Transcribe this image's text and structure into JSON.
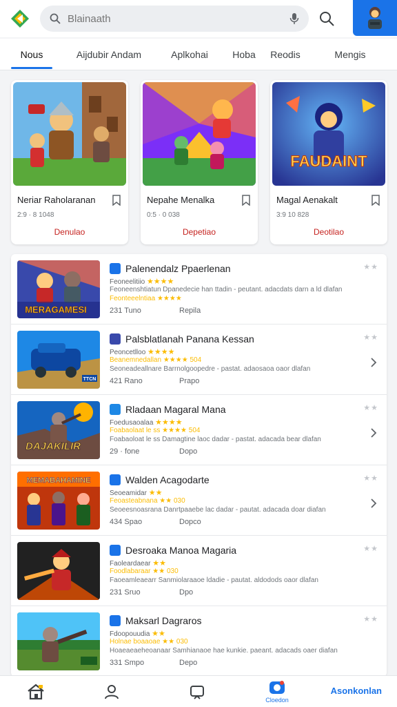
{
  "search": {
    "placeholder": "Blainaath"
  },
  "tabs": [
    {
      "label": "Nous",
      "active": true
    },
    {
      "label": "Aijdubir Andam",
      "active": false
    },
    {
      "label": "Aplkohai",
      "active": false
    },
    {
      "label": "Hoba",
      "active": false
    },
    {
      "label": "Reodis",
      "active": false
    },
    {
      "label": "Mengis",
      "active": false
    }
  ],
  "featured": [
    {
      "title": "Neriar Raholaranan",
      "meta": "2:9 · 8 1048",
      "action": "Denulao"
    },
    {
      "title": "Nepahe Menalka",
      "meta": "0:5 · 0 038",
      "action": "Depetiao"
    },
    {
      "title": "Magal Aenakalt",
      "meta": "3:9 10 828",
      "action": "Deotilao"
    }
  ],
  "featured_art": [
    "FAUDAINT"
  ],
  "list": [
    {
      "name": "Palenendalz Ppaerlenan",
      "sub": "Feoneelitiio",
      "stars": "★★★★",
      "desc": "Feoneenshtiatun  Dpanedecie han ttadin - peutant. adacdats darn a ld dlafan",
      "desc2": "Feonteeelntiaa ★★★★",
      "size": "231 Tuno",
      "price": "Repila",
      "art": "MERAGAMESI",
      "icon_color": "#1a73e8",
      "chevron": false
    },
    {
      "name": "Palsblatlanah Panana Kessan",
      "sub": "Peoncetlloo",
      "stars": "★★★★",
      "desc": "Seoneadeallnare  Barrnolgoopedre - pastat. adaosaoa oaor dlafan",
      "desc2": "Beanemnedallan ★★★★ 504",
      "size": "421 Rano",
      "price": "Prapo",
      "art": "TTCN",
      "icon_color": "#3949ab",
      "chevron": true
    },
    {
      "name": "Rladaan Magaral Mana",
      "sub": "Foedusaoalaa",
      "stars": "★★★★",
      "desc": "Foabaoloat le ss  Damagtine laoc dadar - pastat. adacada bear dlafan",
      "desc2": "Foabaolaat le ss ★★★★ 504",
      "size": "29 · fone",
      "price": "Dopo",
      "art": "DAJAKILIR",
      "icon_color": "#1e88e5",
      "chevron": true
    },
    {
      "name": "Walden Acagodarte",
      "sub": "Seoeamidar",
      "stars": "★★",
      "desc": "Seoeesnoasrana  Danrtpaaebe lac dadar - pautat. adacada doar diafan",
      "desc2": "Feoasteabnana ★★ 030",
      "size": "434 Spao",
      "price": "Dopco",
      "art": "MEMABAHAMINE",
      "icon_color": "#1a73e8",
      "chevron": true
    },
    {
      "name": "Desroaka Manoa Magaria",
      "sub": "Faoleardaear",
      "stars": "★★",
      "desc": "Faoeamleaearr  Sanmiolaraaoe ldadie - pautat. aldodods oaor dlafan",
      "desc2": "Foodlabaraar ★★ 030",
      "size": "231 Sruo",
      "price": "Dpo",
      "art": "",
      "icon_color": "#1a73e8",
      "chevron": false
    },
    {
      "name": "Maksarl Dagraros",
      "sub": "Fdoopouudia",
      "stars": "★★",
      "desc": "Hoaeaeaeheoanaar  Samhianaoe hae kunkie. paeant. adacads oaer diafan",
      "desc2": "Holnae boaaoae ★★ 030",
      "size": "331 Smpo",
      "price": "Depo",
      "art": "",
      "icon_color": "#1a73e8",
      "chevron": false
    }
  ],
  "bottom_nav": {
    "tab_label": "Cloedon",
    "account_label": "Asonkonlan"
  },
  "colors": {
    "accent": "#1a73e8",
    "star": "#fbbc04",
    "download": "#c5221f"
  }
}
